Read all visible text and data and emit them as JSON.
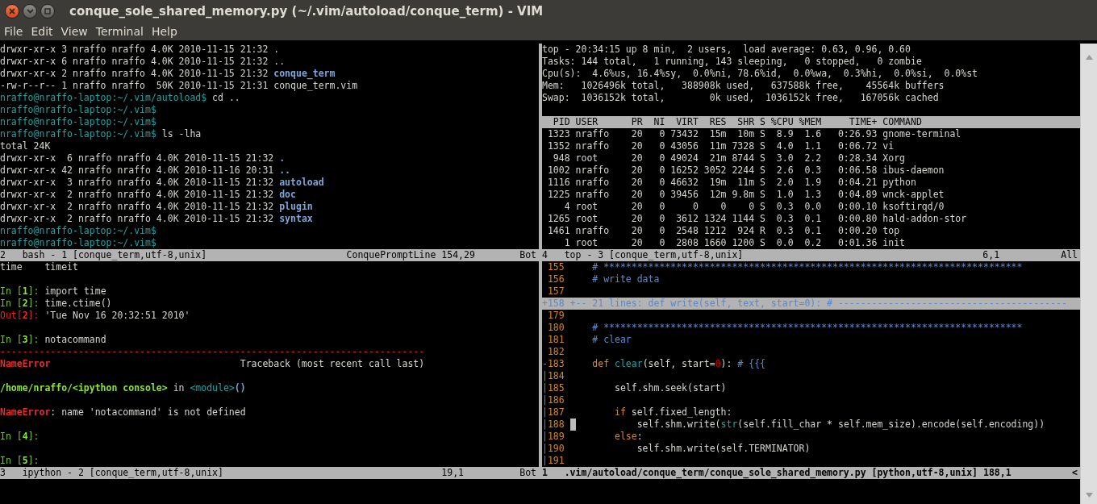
{
  "window": {
    "title": "conque_sole_shared_memory.py (~/.vim/autoload/conque_term) - VIM"
  },
  "menu": [
    "File",
    "Edit",
    "View",
    "Terminal",
    "Help"
  ],
  "top_left": {
    "lines": [
      {
        "kind": "text",
        "segments": [
          {
            "kind": "plain",
            "text": "drwxr-xr-x 3 nraffo nraffo 4.0K 2010-11-15 21:32 ."
          }
        ]
      },
      {
        "kind": "text",
        "segments": [
          {
            "kind": "plain",
            "text": "drwxr-xr-x 6 nraffo nraffo 4.0K 2010-11-15 21:32 .."
          }
        ]
      },
      {
        "kind": "text",
        "segments": [
          {
            "kind": "plain",
            "text": "drwxr-xr-x 2 nraffo nraffo 4.0K 2010-11-15 21:32 "
          },
          {
            "kind": "dir",
            "text": "conque_term"
          }
        ]
      },
      {
        "kind": "text",
        "segments": [
          {
            "kind": "plain",
            "text": "-rw-r--r-- 1 nraffo nraffo  50K 2010-11-15 21:31 conque_term.vim"
          }
        ]
      },
      {
        "kind": "text",
        "segments": [
          {
            "kind": "prompt",
            "text": "nraffo@nraffo-laptop:~/.vim/autoload$"
          },
          {
            "kind": "plain",
            "text": " cd .."
          }
        ]
      },
      {
        "kind": "text",
        "segments": [
          {
            "kind": "prompt",
            "text": "nraffo@nraffo-laptop:~/.vim$"
          }
        ]
      },
      {
        "kind": "text",
        "segments": [
          {
            "kind": "prompt",
            "text": "nraffo@nraffo-laptop:~/.vim$"
          }
        ]
      },
      {
        "kind": "text",
        "segments": [
          {
            "kind": "prompt",
            "text": "nraffo@nraffo-laptop:~/.vim$"
          },
          {
            "kind": "plain",
            "text": " ls -lha"
          }
        ]
      },
      {
        "kind": "text",
        "segments": [
          {
            "kind": "plain",
            "text": "total 24K"
          }
        ]
      },
      {
        "kind": "text",
        "segments": [
          {
            "kind": "plain",
            "text": "drwxr-xr-x  6 nraffo nraffo 4.0K 2010-11-15 21:32 "
          },
          {
            "kind": "dir",
            "text": "."
          }
        ]
      },
      {
        "kind": "text",
        "segments": [
          {
            "kind": "plain",
            "text": "drwxr-xr-x 42 nraffo nraffo 4.0K 2010-11-16 20:31 "
          },
          {
            "kind": "dir",
            "text": ".."
          }
        ]
      },
      {
        "kind": "text",
        "segments": [
          {
            "kind": "plain",
            "text": "drwxr-xr-x  3 nraffo nraffo 4.0K 2010-11-15 21:32 "
          },
          {
            "kind": "dir",
            "text": "autoload"
          }
        ]
      },
      {
        "kind": "text",
        "segments": [
          {
            "kind": "plain",
            "text": "drwxr-xr-x  2 nraffo nraffo 4.0K 2010-11-15 21:32 "
          },
          {
            "kind": "dir",
            "text": "doc"
          }
        ]
      },
      {
        "kind": "text",
        "segments": [
          {
            "kind": "plain",
            "text": "drwxr-xr-x  2 nraffo nraffo 4.0K 2010-11-15 21:32 "
          },
          {
            "kind": "dir",
            "text": "plugin"
          }
        ]
      },
      {
        "kind": "text",
        "segments": [
          {
            "kind": "plain",
            "text": "drwxr-xr-x  2 nraffo nraffo 4.0K 2010-11-15 21:32 "
          },
          {
            "kind": "dir",
            "text": "syntax"
          }
        ]
      },
      {
        "kind": "text",
        "segments": [
          {
            "kind": "prompt",
            "text": "nraffo@nraffo-laptop:~/.vim$"
          }
        ]
      },
      {
        "kind": "text",
        "segments": [
          {
            "kind": "prompt",
            "text": "nraffo@nraffo-laptop:~/.vim$"
          }
        ]
      }
    ],
    "status": {
      "name": "2   bash - 1 [conque_term,utf-8,unix]",
      "info": "ConquePromptLine",
      "ruler": "154,29",
      "scroll": "Bot",
      "active": false
    }
  },
  "top_right": {
    "lines": [
      {
        "kind": "text",
        "segments": [
          {
            "kind": "plain",
            "text": "top - 20:34:15 up 8 min,  2 users,  load average: 0.63, 0.96, 0.60"
          }
        ]
      },
      {
        "kind": "text",
        "segments": [
          {
            "kind": "plain",
            "text": "Tasks: 144 total,   1 running, 143 sleeping,   0 stopped,   0 zombie"
          }
        ]
      },
      {
        "kind": "text",
        "segments": [
          {
            "kind": "plain",
            "text": "Cpu(s):  4.6%us, 16.4%sy,  0.0%ni, 78.6%id,  0.0%wa,  0.3%hi,  0.0%si,  0.0%st"
          }
        ]
      },
      {
        "kind": "text",
        "segments": [
          {
            "kind": "plain",
            "text": "Mem:   1026496k total,   388908k used,   637588k free,    45564k buffers"
          }
        ]
      },
      {
        "kind": "text",
        "segments": [
          {
            "kind": "plain",
            "text": "Swap:  1036152k total,        0k used,  1036152k free,   167056k cached"
          }
        ]
      },
      {
        "kind": "blank"
      },
      {
        "kind": "header",
        "text": "  PID USER      PR  NI  VIRT  RES  SHR S %CPU %MEM     TIME+ COMMAND"
      },
      {
        "kind": "text",
        "segments": [
          {
            "kind": "plain",
            "text": " 1323 nraffo    20   0 73432  15m  10m S  8.9  1.6   0:26.93 gnome-terminal"
          }
        ]
      },
      {
        "kind": "text",
        "segments": [
          {
            "kind": "plain",
            "text": " 1352 nraffo    20   0 43056  11m 7328 S  4.0  1.1   0:06.72 vi"
          }
        ]
      },
      {
        "kind": "text",
        "segments": [
          {
            "kind": "plain",
            "text": "  948 root      20   0 49024  21m 8744 S  3.0  2.2   0:28.34 Xorg"
          }
        ]
      },
      {
        "kind": "text",
        "segments": [
          {
            "kind": "plain",
            "text": " 1002 nraffo    20   0 16252 3052 2244 S  2.6  0.3   0:06.58 ibus-daemon"
          }
        ]
      },
      {
        "kind": "text",
        "segments": [
          {
            "kind": "plain",
            "text": " 1116 nraffo    20   0 46632  19m  11m S  2.0  1.9   0:04.21 python"
          }
        ]
      },
      {
        "kind": "text",
        "segments": [
          {
            "kind": "plain",
            "text": " 1225 nraffo    20   0 39456  12m 9.8m S  1.0  1.3   0:04.89 wnck-applet"
          }
        ]
      },
      {
        "kind": "text",
        "segments": [
          {
            "kind": "plain",
            "text": "    4 root      20   0     0    0    0 S  0.3  0.0   0:00.10 ksoftirqd/0"
          }
        ]
      },
      {
        "kind": "text",
        "segments": [
          {
            "kind": "plain",
            "text": " 1265 root      20   0  3612 1324 1144 S  0.3  0.1   0:00.80 hald-addon-stor"
          }
        ]
      },
      {
        "kind": "text",
        "segments": [
          {
            "kind": "plain",
            "text": " 1461 nraffo    20   0  2548 1212  924 R  0.3  0.1   0:00.20 top"
          }
        ]
      },
      {
        "kind": "text",
        "segments": [
          {
            "kind": "plain",
            "text": "    1 root      20   0  2808 1660 1200 S  0.0  0.2   0:01.36 init"
          }
        ]
      }
    ],
    "status": {
      "name": "4   top - 3 [conque_term,utf-8,unix]",
      "ruler": "6,1",
      "scroll": "All",
      "active": false
    }
  },
  "bottom_left": {
    "lines": [
      {
        "kind": "text",
        "segments": [
          {
            "kind": "plain",
            "text": "time    timeit"
          }
        ]
      },
      {
        "kind": "blank"
      },
      {
        "kind": "text",
        "segments": [
          {
            "kind": "in",
            "text": "In ["
          },
          {
            "kind": "inb",
            "text": "1"
          },
          {
            "kind": "in",
            "text": "]: "
          },
          {
            "kind": "plain",
            "text": "import time"
          }
        ]
      },
      {
        "kind": "text",
        "segments": [
          {
            "kind": "in",
            "text": "In ["
          },
          {
            "kind": "inb",
            "text": "2"
          },
          {
            "kind": "in",
            "text": "]: "
          },
          {
            "kind": "plain",
            "text": "time.ctime()"
          }
        ]
      },
      {
        "kind": "text",
        "segments": [
          {
            "kind": "out",
            "text": "Out["
          },
          {
            "kind": "outb",
            "text": "2"
          },
          {
            "kind": "out",
            "text": "]: "
          },
          {
            "kind": "plain",
            "text": "'Tue Nov 16 20:32:51 2010'"
          }
        ]
      },
      {
        "kind": "blank"
      },
      {
        "kind": "text",
        "segments": [
          {
            "kind": "in",
            "text": "In ["
          },
          {
            "kind": "inb",
            "text": "3"
          },
          {
            "kind": "in",
            "text": "]: "
          },
          {
            "kind": "plain",
            "text": "notacommand"
          }
        ]
      },
      {
        "kind": "text",
        "segments": [
          {
            "kind": "out",
            "text": "----------------------------------------------------------------------------"
          }
        ]
      },
      {
        "kind": "text",
        "segments": [
          {
            "kind": "outb",
            "text": "NameError"
          },
          {
            "kind": "plain",
            "text": "                                  Traceback (most recent call last)"
          }
        ]
      },
      {
        "kind": "blank"
      },
      {
        "kind": "text",
        "segments": [
          {
            "kind": "inb",
            "text": "/home/nraffo/<ipython console>"
          },
          {
            "kind": "plain",
            "text": " in "
          },
          {
            "kind": "func",
            "text": "<module>"
          },
          {
            "kind": "paren",
            "text": "()"
          }
        ]
      },
      {
        "kind": "blank"
      },
      {
        "kind": "text",
        "segments": [
          {
            "kind": "outb",
            "text": "NameError"
          },
          {
            "kind": "plain",
            "text": ": name 'notacommand' is not defined"
          }
        ]
      },
      {
        "kind": "blank"
      },
      {
        "kind": "text",
        "segments": [
          {
            "kind": "in",
            "text": "In ["
          },
          {
            "kind": "inb",
            "text": "4"
          },
          {
            "kind": "in",
            "text": "]:"
          }
        ]
      },
      {
        "kind": "blank"
      },
      {
        "kind": "text",
        "segments": [
          {
            "kind": "in",
            "text": "In ["
          },
          {
            "kind": "inb",
            "text": "5"
          },
          {
            "kind": "in",
            "text": "]:"
          }
        ]
      }
    ],
    "status": {
      "name": "3   ipython - 2 [conque_term,utf-8,unix]",
      "ruler": "19,1",
      "scroll": "Bot",
      "active": false
    }
  },
  "bottom_right": {
    "lines": [
      {
        "kind": "code",
        "number": "155",
        "segments": [
          {
            "kind": "comment",
            "text": "   # ***************************************************************************"
          }
        ]
      },
      {
        "kind": "code",
        "number": "156",
        "segments": [
          {
            "kind": "comment",
            "text": "   # write data"
          }
        ]
      },
      {
        "kind": "code",
        "number": "157"
      },
      {
        "kind": "fold",
        "gutter": "+",
        "number": "158",
        "segments": [
          {
            "kind": "comment",
            "text": "+-- 21 lines: def write(self, text, start=0): # -----------------------------------------"
          }
        ]
      },
      {
        "kind": "code",
        "number": "179"
      },
      {
        "kind": "code",
        "number": "180",
        "segments": [
          {
            "kind": "comment",
            "text": "   # ***************************************************************************"
          }
        ]
      },
      {
        "kind": "code",
        "number": "181",
        "segments": [
          {
            "kind": "comment",
            "text": "   # clear"
          }
        ]
      },
      {
        "kind": "code",
        "number": "182"
      },
      {
        "kind": "code",
        "gutter": "-",
        "number": "183",
        "segments": [
          {
            "kind": "keyword",
            "text": "   def "
          },
          {
            "kind": "func",
            "text": "clear"
          },
          {
            "kind": "plain",
            "text": "(self, start="
          },
          {
            "kind": "num",
            "text": "0"
          },
          {
            "kind": "plain",
            "text": "): "
          },
          {
            "kind": "comment",
            "text": "# {{{"
          }
        ]
      },
      {
        "kind": "code",
        "gutter": "|",
        "number": "184"
      },
      {
        "kind": "code",
        "gutter": "|",
        "number": "185",
        "segments": [
          {
            "kind": "plain",
            "text": "       self.shm.seek(start)"
          }
        ]
      },
      {
        "kind": "code",
        "gutter": "|",
        "number": "186"
      },
      {
        "kind": "code",
        "gutter": "|",
        "number": "187",
        "segments": [
          {
            "kind": "keyword",
            "text": "       if"
          },
          {
            "kind": "plain",
            "text": " self.fixed_length:"
          }
        ]
      },
      {
        "kind": "code",
        "gutter": "|",
        "number": "188",
        "cursor": true,
        "segments": [
          {
            "kind": "plain",
            "text": "           self.shm.write("
          },
          {
            "kind": "func",
            "text": "str"
          },
          {
            "kind": "plain",
            "text": "(self.fill_char * self.mem_size).encode(self.encoding))"
          }
        ]
      },
      {
        "kind": "code",
        "gutter": "|",
        "number": "189",
        "segments": [
          {
            "kind": "keyword",
            "text": "       else"
          },
          {
            "kind": "plain",
            "text": ":"
          }
        ]
      },
      {
        "kind": "code",
        "gutter": "|",
        "number": "190",
        "segments": [
          {
            "kind": "plain",
            "text": "           self.shm.write(self.TERMINATOR)"
          }
        ]
      },
      {
        "kind": "code",
        "gutter": "|",
        "number": "191"
      }
    ],
    "status": {
      "name": "1   .vim/autoload/conque_term/conque_sole_shared_memory.py [python,utf-8,unix]",
      "ruler": "188,1",
      "scroll": "<",
      "active": true
    }
  }
}
